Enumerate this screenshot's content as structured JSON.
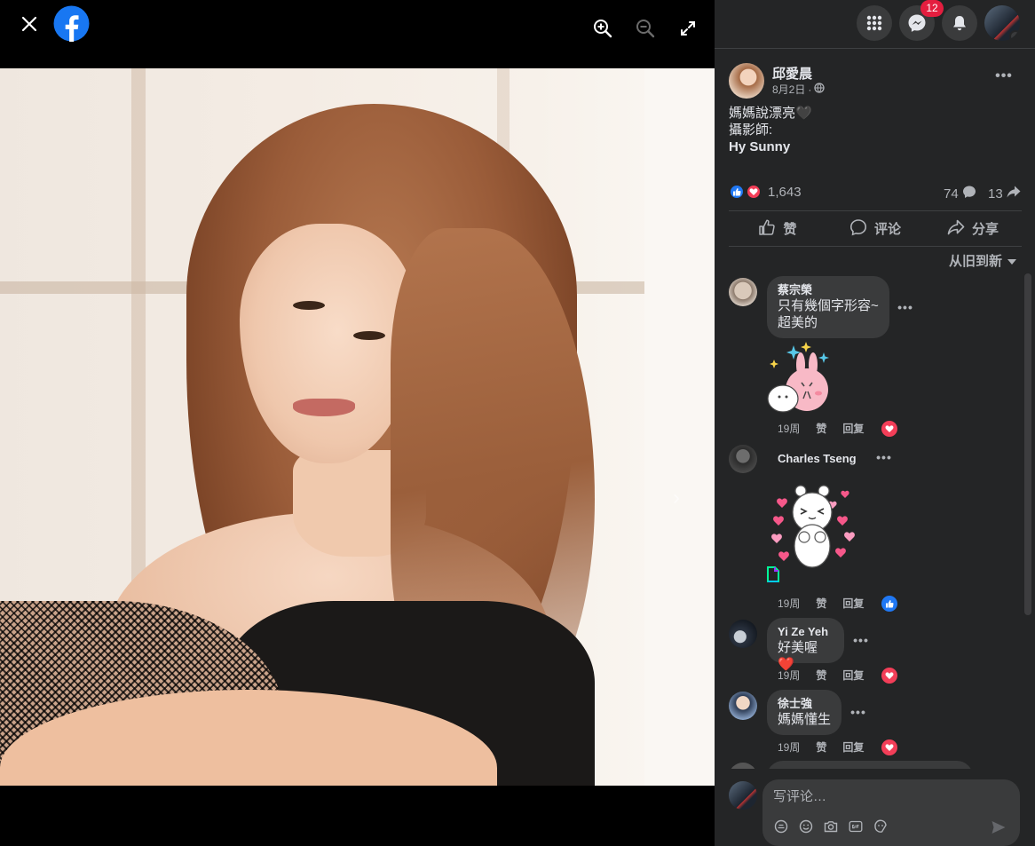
{
  "viewer": {
    "has_next": true
  },
  "topbar": {
    "messenger_badge": "12"
  },
  "post": {
    "author": "邱愛晨",
    "date": "8月2日",
    "separator": "·",
    "text_lines": [
      "媽媽說漂亮🖤",
      "攝影師:",
      "Hy Sunny"
    ],
    "reaction_count": "1,643",
    "comment_count": "74",
    "share_count": "13"
  },
  "actions": {
    "like": "赞",
    "comment": "评论",
    "share": "分享"
  },
  "sort_label": "从旧到新",
  "comments": [
    {
      "name": "蔡宗榮",
      "text": "只有幾個字形容~\n超美的",
      "time": "19周",
      "like": "赞",
      "reply": "回复",
      "reaction": "love",
      "sticker": "rabbit-sticker"
    },
    {
      "name": "Charles Tseng",
      "text": "",
      "time": "19周",
      "like": "赞",
      "reply": "回复",
      "reaction": "like",
      "sticker": "bear-hearts-sticker"
    },
    {
      "name": "Yi Ze Yeh",
      "text": "好美喔❤️",
      "time": "19周",
      "like": "赞",
      "reply": "回复",
      "reaction": "love"
    },
    {
      "name": "徐士強",
      "text": "媽媽懂生",
      "time": "19周",
      "like": "赞",
      "reply": "回复",
      "reaction": "love"
    }
  ],
  "composer": {
    "placeholder": "写评论…"
  },
  "colors": {
    "panel_bg": "#242526",
    "bubble_bg": "#3a3b3c",
    "fb_blue": "#1877f2",
    "love_red": "#f33e58",
    "badge_red": "#e41e3f"
  }
}
